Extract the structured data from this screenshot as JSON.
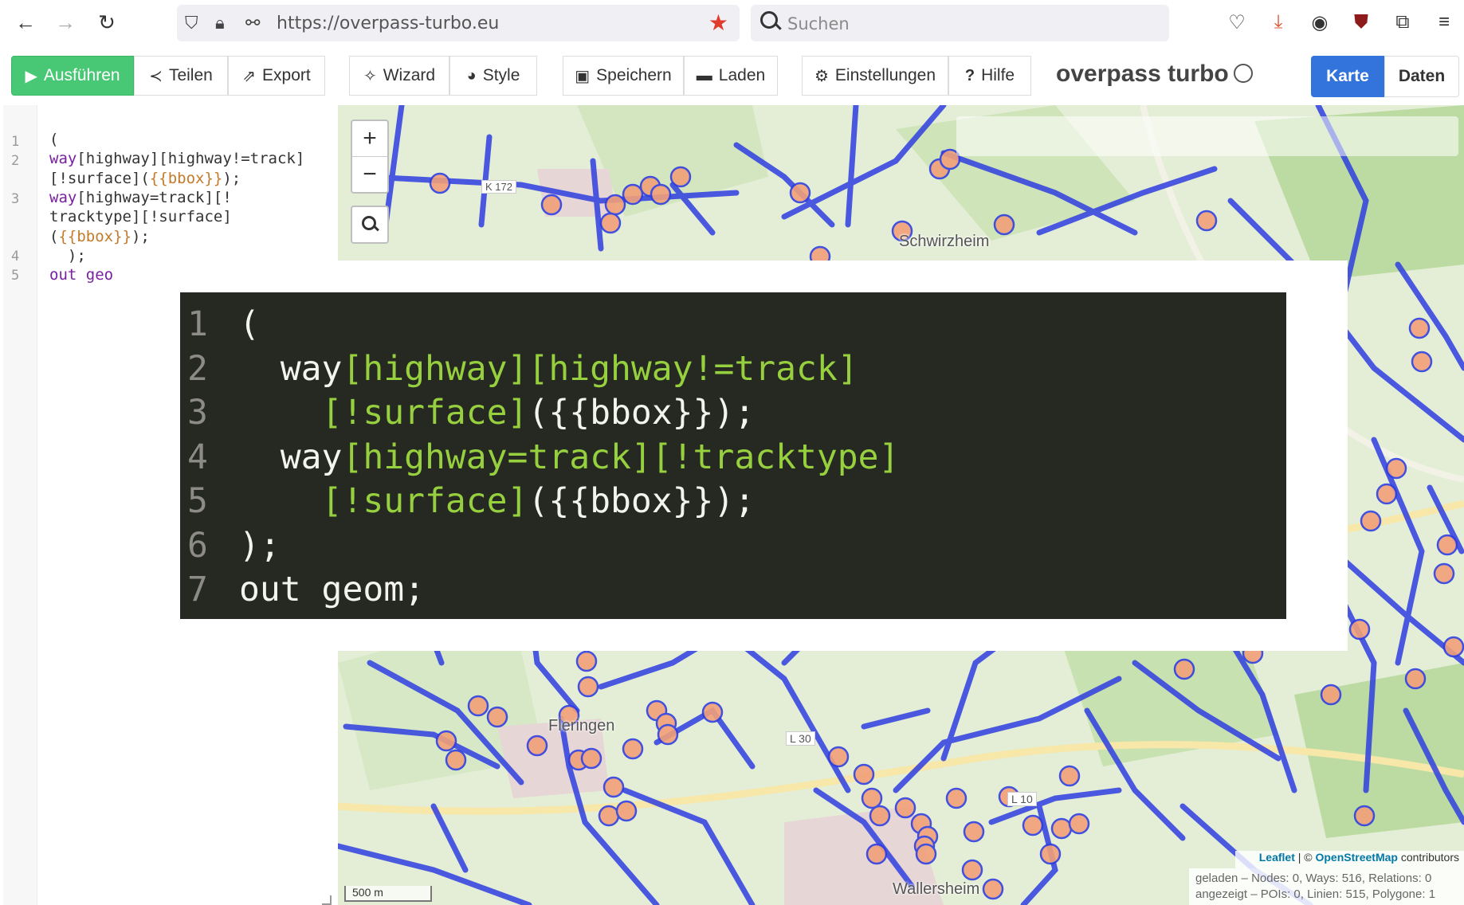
{
  "browser": {
    "url": "https://overpass-turbo.eu",
    "search_placeholder": "Suchen"
  },
  "toolbar": {
    "run_label": "Ausführen",
    "share_label": "Teilen",
    "export_label": "Export",
    "wizard_label": "Wizard",
    "style_label": "Style",
    "save_label": "Speichern",
    "load_label": "Laden",
    "settings_label": "Einstellungen",
    "help_label": "Hilfe",
    "brand": "overpass turbo",
    "view_map_label": "Karte",
    "view_data_label": "Daten"
  },
  "editor": {
    "line_numbers": [
      "1",
      "2",
      "3",
      "4",
      "5"
    ],
    "lines": [
      {
        "parts": [
          [
            "b",
            "("
          ]
        ]
      },
      {
        "parts": [
          [
            "k",
            "way"
          ],
          [
            "b",
            "[highway][highway!=track]"
          ]
        ]
      },
      {
        "parts": [
          [
            "b",
            "[!surface]("
          ],
          [
            "t",
            "{{bbox}}"
          ],
          [
            "b",
            ");"
          ]
        ]
      },
      {
        "parts": [
          [
            "k",
            "way"
          ],
          [
            "b",
            "[highway=track][!"
          ]
        ]
      },
      {
        "parts": [
          [
            "b",
            "tracktype][!surface]"
          ]
        ]
      },
      {
        "parts": [
          [
            "b",
            "("
          ],
          [
            "t",
            "{{bbox}}"
          ],
          [
            "b",
            ");"
          ]
        ]
      },
      {
        "parts": [
          [
            "b",
            "  );"
          ]
        ]
      },
      {
        "parts": [
          [
            "k",
            "out geo"
          ]
        ]
      }
    ]
  },
  "map": {
    "places": [
      "Schwirzheim",
      "Fleringen",
      "Wallersheim"
    ],
    "road_labels": [
      "L 30",
      "L 10",
      "K 172"
    ],
    "scale": "500 m",
    "attribution_leaflet": "Leaflet",
    "attribution_sep": " | © ",
    "attribution_osm": "OpenStreetMap",
    "attribution_tail": " contributors",
    "stats_loaded": "geladen – Nodes: 0, Ways: 516, Relations: 0",
    "stats_shown": "angezeigt – POIs: 0, Linien: 515, Polygone: 1"
  },
  "overlay_code": {
    "line_numbers": [
      "1",
      "2",
      "3",
      "4",
      "5",
      "6",
      "7"
    ],
    "lines": [
      {
        "parts": [
          [
            "w",
            "("
          ]
        ]
      },
      {
        "parts": [
          [
            "w",
            "  way"
          ],
          [
            "g",
            "[highway][highway!=track]"
          ]
        ]
      },
      {
        "parts": [
          [
            "w",
            "    "
          ],
          [
            "g",
            "[!surface]"
          ],
          [
            "w",
            "({{bbox}});"
          ]
        ]
      },
      {
        "parts": [
          [
            "w",
            "  way"
          ],
          [
            "g",
            "[highway=track][!tracktype]"
          ]
        ]
      },
      {
        "parts": [
          [
            "w",
            "    "
          ],
          [
            "g",
            "[!surface]"
          ],
          [
            "w",
            "({{bbox}});"
          ]
        ]
      },
      {
        "parts": [
          [
            "w",
            ");"
          ]
        ]
      },
      {
        "parts": [
          [
            "w",
            "out geom;"
          ]
        ]
      }
    ]
  },
  "colors": {
    "run_green": "#48c774",
    "karte_blue": "#3273dc",
    "way_blue": "#2f3fe0",
    "poi_orange": "#f2a079",
    "code_bg": "#262822",
    "code_green": "#97d03f"
  }
}
